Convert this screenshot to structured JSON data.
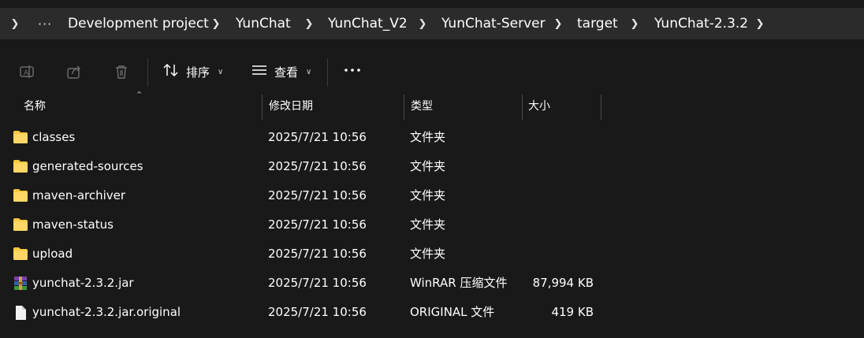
{
  "breadcrumb": {
    "more_label": "···",
    "items": [
      "Development project",
      "YunChat",
      "YunChat_V2",
      "YunChat-Server",
      "target",
      "YunChat-2.3.2"
    ]
  },
  "toolbar": {
    "rename_icon": "rename-icon",
    "share_icon": "share-icon",
    "delete_icon": "trash-icon",
    "sort_label": "排序",
    "view_label": "查看",
    "more_label": "···"
  },
  "columns": {
    "name": "名称",
    "date": "修改日期",
    "type": "类型",
    "size": "大小"
  },
  "files": [
    {
      "name": "classes",
      "date": "2025/7/21 10:56",
      "type": "文件夹",
      "size": "",
      "icon": "folder-icon"
    },
    {
      "name": "generated-sources",
      "date": "2025/7/21 10:56",
      "type": "文件夹",
      "size": "",
      "icon": "folder-icon"
    },
    {
      "name": "maven-archiver",
      "date": "2025/7/21 10:56",
      "type": "文件夹",
      "size": "",
      "icon": "folder-icon"
    },
    {
      "name": "maven-status",
      "date": "2025/7/21 10:56",
      "type": "文件夹",
      "size": "",
      "icon": "folder-icon"
    },
    {
      "name": "upload",
      "date": "2025/7/21 10:56",
      "type": "文件夹",
      "size": "",
      "icon": "folder-icon"
    },
    {
      "name": "yunchat-2.3.2.jar",
      "date": "2025/7/21 10:56",
      "type": "WinRAR 压缩文件",
      "size": "87,994 KB",
      "icon": "winrar-archive-icon"
    },
    {
      "name": "yunchat-2.3.2.jar.original",
      "date": "2025/7/21 10:56",
      "type": "ORIGINAL 文件",
      "size": "419 KB",
      "icon": "file-icon"
    }
  ],
  "colors": {
    "background": "#191919",
    "breadcrumb_bar": "#2b2b2b",
    "folder": "#f8c940"
  }
}
